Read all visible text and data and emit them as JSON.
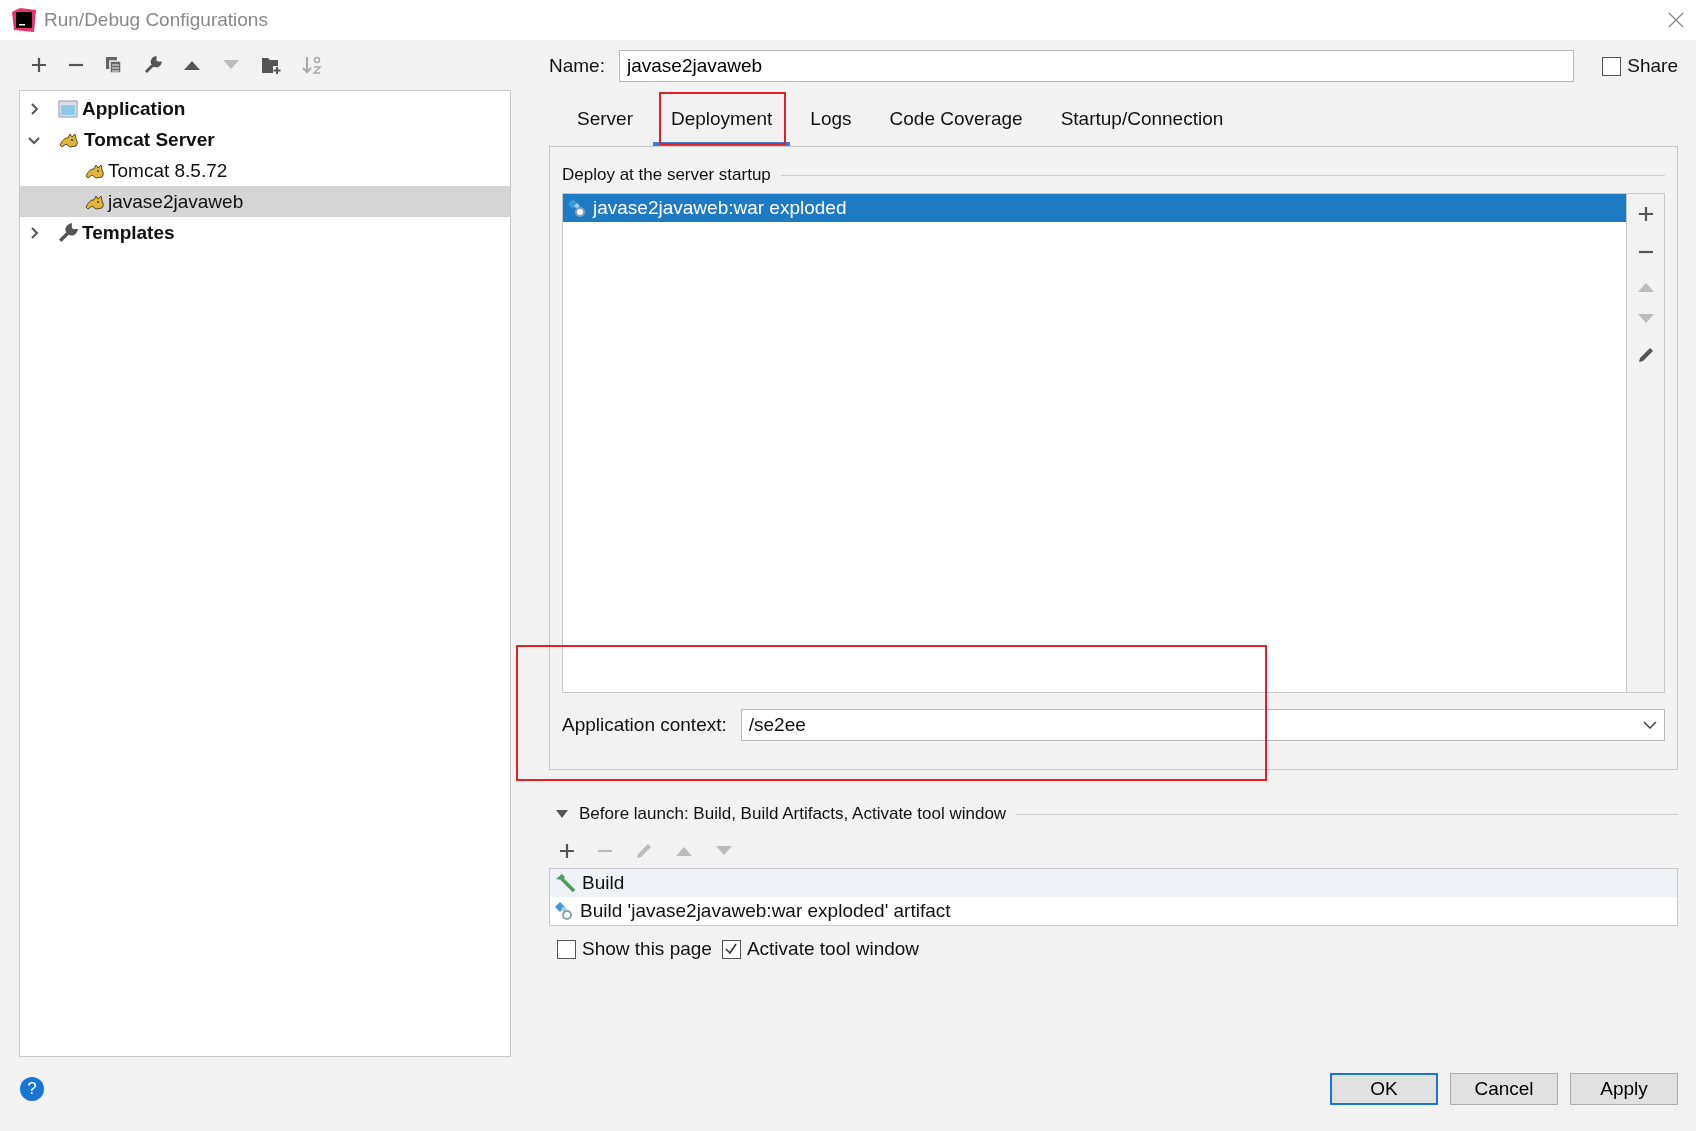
{
  "window": {
    "title": "Run/Debug Configurations"
  },
  "tree": [
    {
      "label": "Application",
      "kind": "application",
      "expanded": false,
      "selected": false
    },
    {
      "label": "Tomcat Server",
      "kind": "tomcat",
      "expanded": true,
      "selected": false,
      "children": [
        {
          "label": "Tomcat 8.5.72",
          "kind": "tomcat",
          "selected": false
        },
        {
          "label": "javase2javaweb",
          "kind": "tomcat",
          "selected": true
        }
      ]
    },
    {
      "label": "Templates",
      "kind": "templates",
      "expanded": false,
      "selected": false
    }
  ],
  "name_field": {
    "label": "Name:",
    "value": "javase2javaweb"
  },
  "share": {
    "label": "Share",
    "checked": false
  },
  "tabs": [
    {
      "label": "Server",
      "selected": false,
      "highlighted": false
    },
    {
      "label": "Deployment",
      "selected": true,
      "highlighted": true
    },
    {
      "label": "Logs",
      "selected": false,
      "highlighted": false
    },
    {
      "label": "Code Coverage",
      "selected": false,
      "highlighted": false
    },
    {
      "label": "Startup/Connection",
      "selected": false,
      "highlighted": false
    }
  ],
  "deployment": {
    "title": "Deploy at the server startup",
    "artifacts": [
      {
        "label": "javase2javaweb:war exploded",
        "selected": true
      }
    ],
    "app_context": {
      "label": "Application context:",
      "value": "/se2ee",
      "highlighted": true
    }
  },
  "before_launch": {
    "title": "Before launch: Build, Build Artifacts, Activate tool window",
    "expanded": true,
    "tasks": [
      {
        "label": "Build",
        "kind": "build",
        "selected": true
      },
      {
        "label": "Build 'javase2javaweb:war exploded' artifact",
        "kind": "artifact",
        "selected": false
      }
    ],
    "options": [
      {
        "label": "Show this page",
        "checked": false
      },
      {
        "label": "Activate tool window",
        "checked": true
      }
    ]
  },
  "help": {
    "label": "?"
  },
  "buttons": [
    {
      "label": "OK",
      "default": true
    },
    {
      "label": "Cancel",
      "default": false
    },
    {
      "label": "Apply",
      "default": false
    }
  ]
}
